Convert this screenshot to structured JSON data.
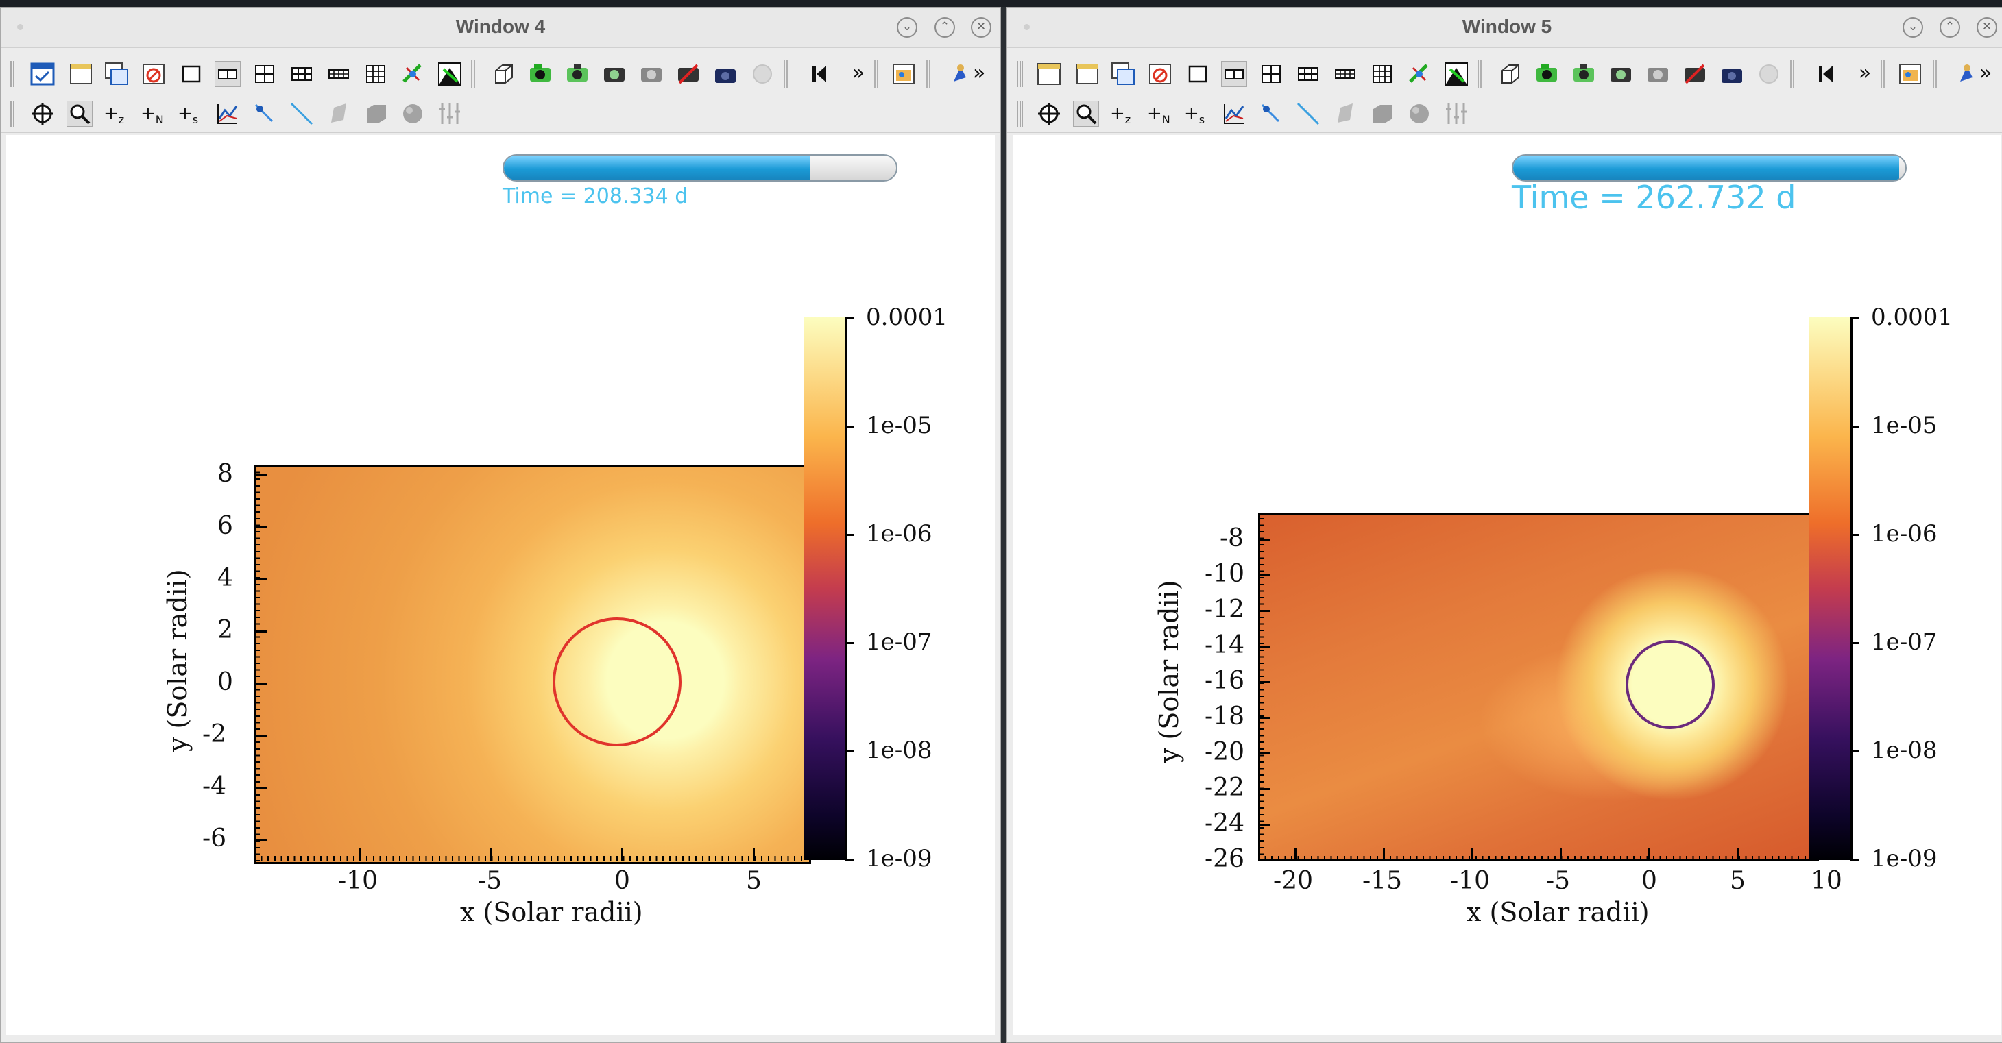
{
  "windows": [
    {
      "id": "win4",
      "title": "Window 4",
      "time_text": "Time = 208.334 d",
      "time_progress": 0.78,
      "plot": {
        "xlabel": "x (Solar radii)",
        "ylabel": "y (Solar radii)",
        "x_ticks": [
          "-10",
          "-5",
          "0",
          "5"
        ],
        "y_ticks": [
          "8",
          "6",
          "4",
          "2",
          "0",
          "-2",
          "-4",
          "-6"
        ],
        "xlim": [
          -14,
          8.5
        ],
        "ylim": [
          -7,
          8.3
        ],
        "circle_color": "#e0342c"
      },
      "colorbar": {
        "labels": [
          "0.0001",
          "1e-05",
          "1e-06",
          "1e-07",
          "1e-08",
          "1e-09"
        ],
        "scale": "log"
      }
    },
    {
      "id": "win5",
      "title": "Window 5",
      "time_text": "Time = 262.732 d",
      "time_progress": 0.985,
      "plot": {
        "xlabel": "x (Solar radii)",
        "ylabel": "y (Solar radii)",
        "x_ticks": [
          "-20",
          "-15",
          "-10",
          "-5",
          "0",
          "5",
          "10"
        ],
        "y_ticks": [
          "-8",
          "-10",
          "-12",
          "-14",
          "-16",
          "-18",
          "-20",
          "-22",
          "-24",
          "-26"
        ],
        "xlim": [
          -22,
          11.5
        ],
        "ylim": [
          -26,
          -6.5
        ],
        "circle_color": "#6b2a7d"
      },
      "colorbar": {
        "labels": [
          "0.0001",
          "1e-05",
          "1e-06",
          "1e-07",
          "1e-08",
          "1e-09"
        ],
        "scale": "log"
      }
    }
  ],
  "icons": {
    "toolbar1": [
      "invert-background-icon",
      "new-window-icon",
      "clone-window-icon",
      "delete-window-icon",
      "layout-1x1-icon",
      "layout-1x2-icon",
      "layout-2x2-icon",
      "layout-2x3-icon",
      "layout-2x4-icon",
      "layout-3x3-icon",
      "apply-operator-icon",
      "spin-mode-icon",
      "bounding-box-icon",
      "camera-icon",
      "save-image-icon",
      "export-icon",
      "print-icon",
      "lock-icon",
      "reverse-step-icon",
      "more-icon",
      "lighting-icon",
      "pick-icon"
    ],
    "toolbar2": [
      "navigate-icon",
      "zoom-icon",
      "zone-pick-icon",
      "node-pick-icon",
      "spreadsheet-pick-icon",
      "lineout-icon",
      "point-tool-icon",
      "line-tool-icon",
      "plane-tool-icon",
      "box-tool-icon",
      "sphere-tool-icon",
      "axis-restrict-icon"
    ]
  }
}
